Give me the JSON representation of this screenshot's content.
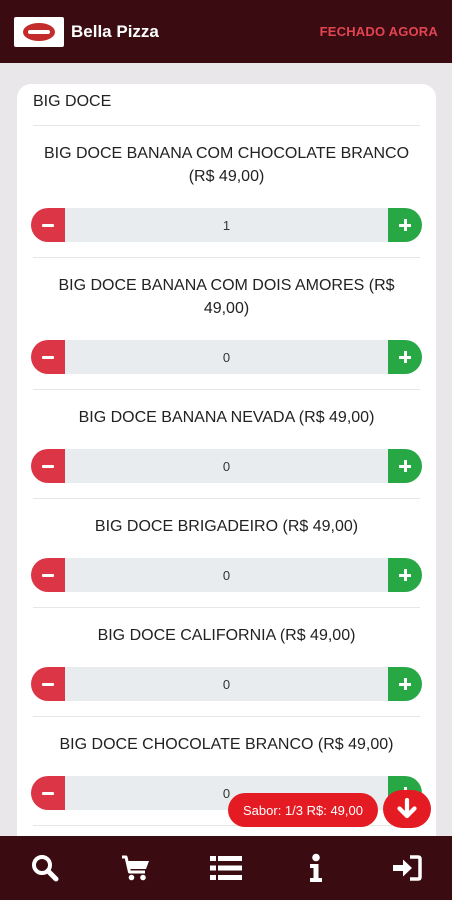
{
  "header": {
    "brand": "Bella Pizza",
    "status": "FECHADO AGORA"
  },
  "section": {
    "title": "BIG DOCE"
  },
  "items": [
    {
      "name": "BIG DOCE BANANA COM CHOCOLATE BRANCO (R$ 49,00)",
      "qty": "1"
    },
    {
      "name": "BIG DOCE BANANA COM DOIS AMORES (R$ 49,00)",
      "qty": "0"
    },
    {
      "name": "BIG DOCE BANANA NEVADA (R$ 49,00)",
      "qty": "0"
    },
    {
      "name": "BIG DOCE BRIGADEIRO (R$ 49,00)",
      "qty": "0"
    },
    {
      "name": "BIG DOCE CALIFORNIA (R$ 49,00)",
      "qty": "0"
    },
    {
      "name": "BIG DOCE CHOCOLATE BRANCO (R$ 49,00)",
      "qty": "0"
    }
  ],
  "summary": {
    "label": "Sabor: 1/3 R$: 49,00"
  },
  "nav": {
    "items": [
      "search-icon",
      "cart-icon",
      "list-icon",
      "info-icon",
      "sign-in-icon"
    ]
  },
  "colors": {
    "bar": "#3a0c12",
    "status": "#e24452",
    "minus": "#dc3545",
    "plus": "#28a745",
    "accent": "#e51b23"
  }
}
